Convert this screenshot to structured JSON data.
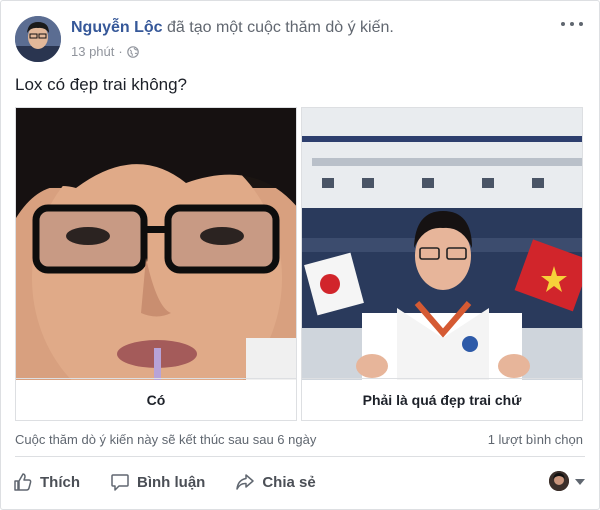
{
  "post": {
    "author": "Nguyễn Lộc",
    "action_text": "đã tạo một cuộc thăm dò ý kiến.",
    "timestamp": "13 phút",
    "privacy_icon": "globe-icon",
    "menu_icon": "more-icon"
  },
  "poll": {
    "question": "Lox có đẹp trai không?",
    "options": [
      {
        "label": "Có"
      },
      {
        "label": "Phải là quá đẹp trai chứ"
      }
    ],
    "status_text": "Cuộc thăm dò ý kiến này sẽ kết thúc sau sau 6 ngày",
    "votes_text": "1 lượt bình chọn"
  },
  "actions": {
    "like": "Thích",
    "comment": "Bình luận",
    "share": "Chia sẻ"
  },
  "colors": {
    "author": "#365899",
    "muted": "#90949c",
    "border": "#dddfe2"
  }
}
